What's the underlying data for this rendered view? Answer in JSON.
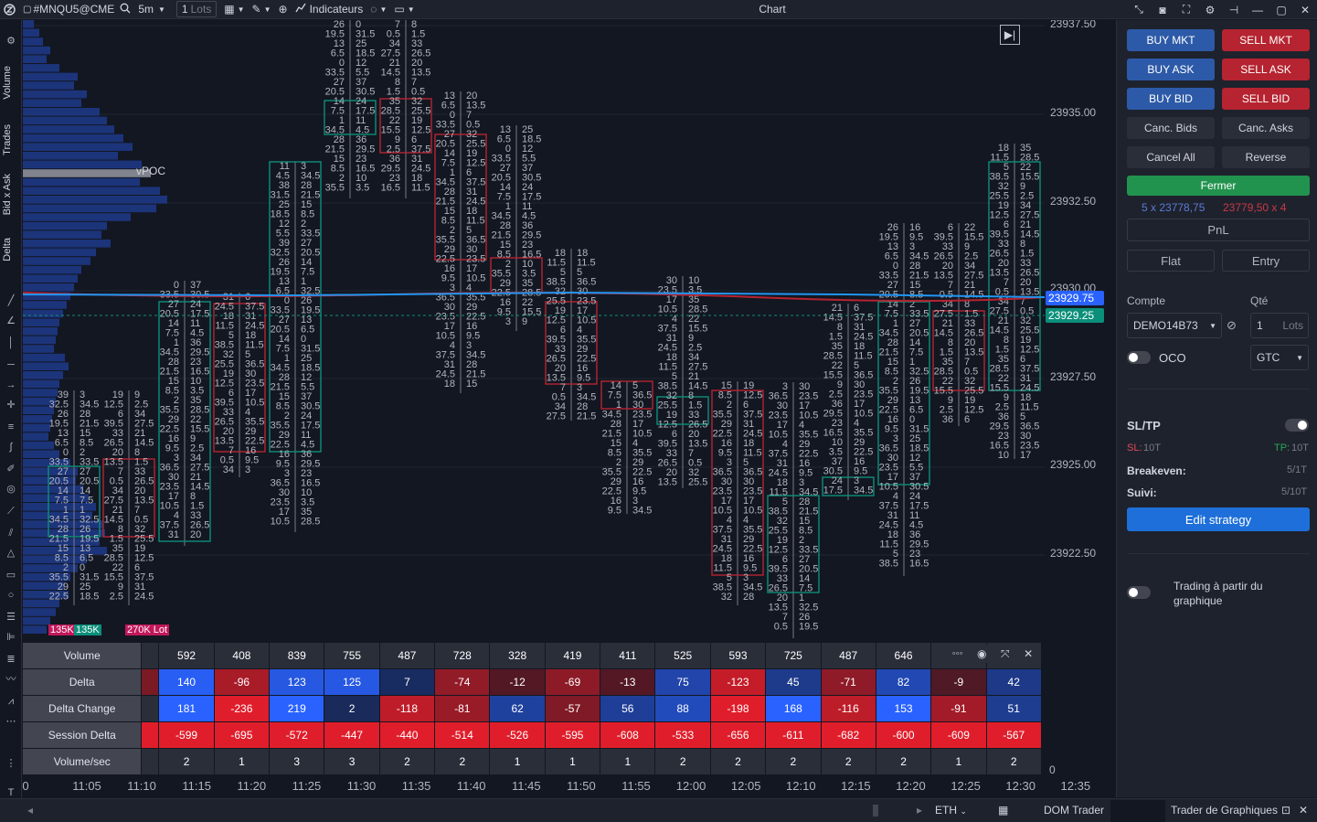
{
  "topbar": {
    "symbol": "#MNQU5@CME",
    "timeframe": "5m",
    "lots_value": "1",
    "lots_unit": "Lots",
    "indicators_label": "Indicateurs",
    "title": "Chart"
  },
  "left_tabs": {
    "volume": "Volume",
    "trades": "Trades",
    "bidask": "Bid x Ask",
    "delta": "Delta"
  },
  "chart": {
    "vpoc_label": "vPOC",
    "profile_labels": [
      "135K",
      "135K",
      "270K Lot"
    ],
    "price_axis": [
      "23937.50",
      "23935.00",
      "23932.50",
      "23930.00",
      "23927.50",
      "23925.00",
      "23922.50"
    ],
    "current_price": "23929.75",
    "current_price_color": "#2962ff",
    "level_price": "23929.25",
    "level_price_color": "#0c8f7a",
    "bid_color": "#b52430",
    "ask_color": "#0c8f7a",
    "highlight_color": "#ffeb3b"
  },
  "bottom_table": {
    "rows": [
      {
        "label": "Volume",
        "values": [
          "592",
          "408",
          "839",
          "755",
          "487",
          "728",
          "328",
          "419",
          "411",
          "525",
          "593",
          "725",
          "487",
          "646",
          "",
          "",
          ""
        ]
      },
      {
        "label": "Delta",
        "values": [
          "140",
          "-96",
          "123",
          "125",
          "7",
          "-74",
          "-12",
          "-69",
          "-13",
          "75",
          "-123",
          "45",
          "-71",
          "82",
          "-9",
          "42"
        ]
      },
      {
        "label": "Delta Change",
        "values": [
          "181",
          "-236",
          "219",
          "2",
          "-118",
          "-81",
          "62",
          "-57",
          "56",
          "88",
          "-198",
          "168",
          "-116",
          "153",
          "-91",
          "51"
        ]
      },
      {
        "label": "Session Delta",
        "values": [
          "-599",
          "-695",
          "-572",
          "-447",
          "-440",
          "-514",
          "-526",
          "-595",
          "-608",
          "-533",
          "-656",
          "-611",
          "-682",
          "-600",
          "-609",
          "-567"
        ]
      },
      {
        "label": "Volume/sec",
        "values": [
          "2",
          "1",
          "3",
          "3",
          "2",
          "2",
          "1",
          "1",
          "1",
          "2",
          "2",
          "2",
          "2",
          "2",
          "1",
          "2"
        ]
      }
    ],
    "right_zero": "0"
  },
  "x_axis": [
    "11:05",
    "11:10",
    "11:15",
    "11:20",
    "11:25",
    "11:30",
    "11:35",
    "11:40",
    "11:45",
    "11:50",
    "11:55",
    "12:00",
    "12:05",
    "12:10",
    "12:15",
    "12:20",
    "12:25",
    "12:30",
    "12:35"
  ],
  "x_axis_first": "0",
  "statusbar": {
    "session": "ETH",
    "dom_trader": "DOM Trader",
    "trader_graphiques": "Trader de Graphiques"
  },
  "panel": {
    "buy_mkt": "BUY MKT",
    "sell_mkt": "SELL MKT",
    "buy_ask": "BUY ASK",
    "sell_ask": "SELL ASK",
    "buy_bid": "BUY BID",
    "sell_bid": "SELL BID",
    "canc_bids": "Canc. Bids",
    "canc_asks": "Canc. Asks",
    "cancel_all": "Cancel All",
    "reverse": "Reverse",
    "fermer": "Fermer",
    "bid_quote": "5 x 23778,75",
    "ask_quote": "23779,50 x 4",
    "pnl": "PnL",
    "flat": "Flat",
    "entry": "Entry",
    "compte_label": "Compte",
    "qte_label": "Qté",
    "account": "DEMO14B73",
    "qty": "1",
    "qty_unit": "Lots",
    "oco": "OCO",
    "gtc": "GTC",
    "sltp": "SL/TP",
    "sl": "SL:",
    "sl_val": "10T",
    "tp": "TP:",
    "tp_val": "10T",
    "breakeven": "Breakeven:",
    "breakeven_val": "5/1T",
    "suivi": "Suivi:",
    "suivi_val": "5/10T",
    "edit_strategy": "Edit strategy",
    "trading_chart": "Trading à partir du graphique"
  }
}
